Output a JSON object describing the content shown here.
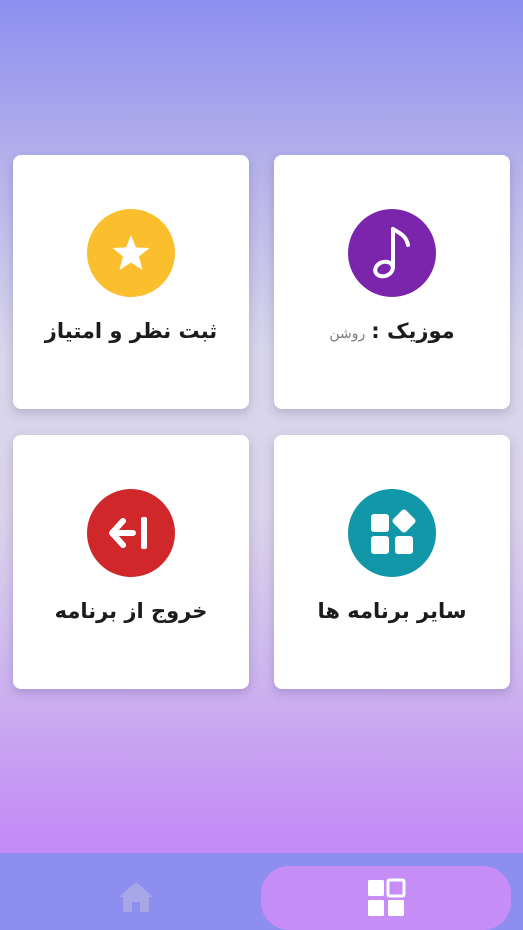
{
  "cards": {
    "music": {
      "label": "موزیک :",
      "status": "روشن",
      "icon": "music-note-icon",
      "color": "#7b25ad"
    },
    "rate": {
      "label": "ثبت نظر و امتیاز",
      "icon": "star-icon",
      "color": "#fbbf2d"
    },
    "other_apps": {
      "label": "سایر برنامه ها",
      "icon": "apps-grid-icon",
      "color": "#1197a7"
    },
    "exit": {
      "label": "خروج از برنامه",
      "icon": "exit-icon",
      "color": "#d0282a"
    }
  },
  "bottom_nav": {
    "items": [
      {
        "icon": "home-icon",
        "active": false
      },
      {
        "icon": "apps-grid-icon",
        "active": true
      }
    ],
    "background": "#8d8ef0",
    "active_pill": "#c78df7"
  }
}
